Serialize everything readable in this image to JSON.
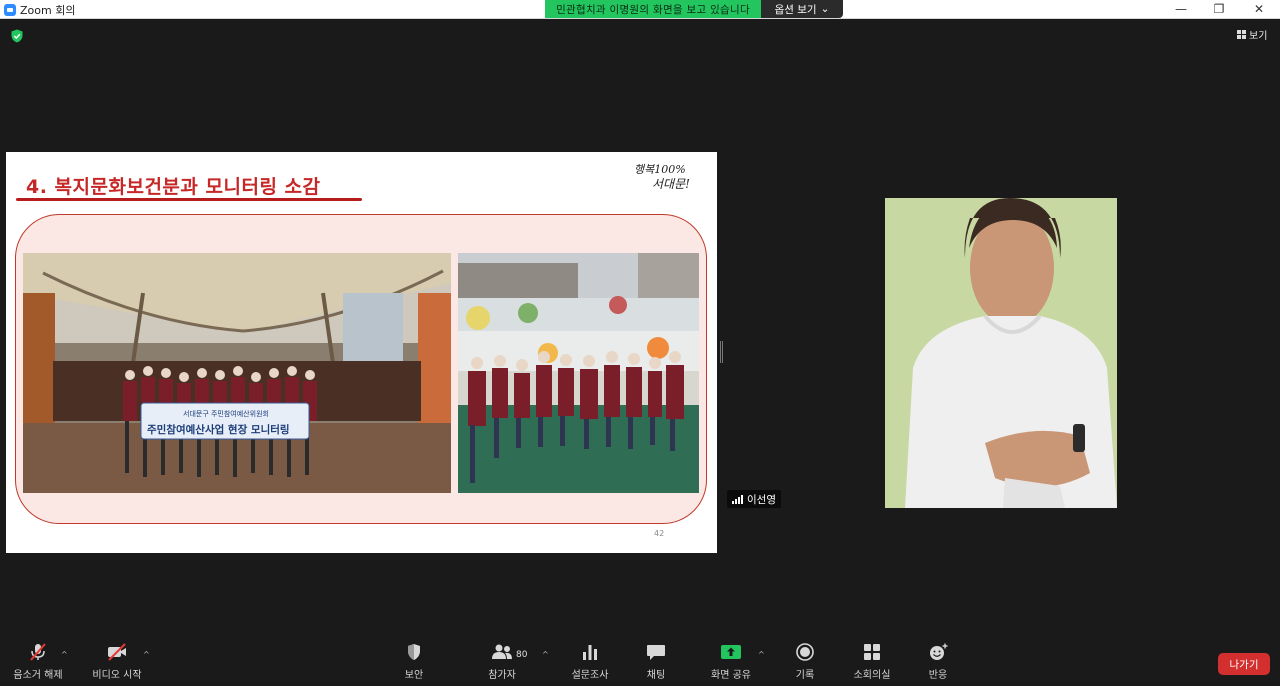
{
  "window": {
    "title": "Zoom 회의",
    "minimize": "—",
    "restore": "❐",
    "close": "✕"
  },
  "share_banner": {
    "text": "민관협치과 이명원의 화면을 보고 있습니다",
    "options_label": "옵션 보기",
    "options_caret": "⌄"
  },
  "view_button": {
    "label": "보기"
  },
  "slide": {
    "title": "4. 복지문화보건분과 모니터링 소감",
    "logo_text_line1": "행복100%",
    "logo_text_line2": "서대문!",
    "banner_org": "서대문구 주민참여예산위원회",
    "banner_text": "주민참여예산사업 현장 모니터링",
    "page_number": "42"
  },
  "participant": {
    "name": "이선영"
  },
  "toolbar": {
    "unmute_label": "음소거 해제",
    "video_label": "비디오 시작",
    "security_label": "보안",
    "participants_label": "참가자",
    "participants_count": "80",
    "poll_label": "설문조사",
    "chat_label": "채팅",
    "share_label": "화면 공유",
    "record_label": "기록",
    "breakout_label": "소회의실",
    "reactions_label": "반응",
    "leave_label": "나가기",
    "caret": "^"
  },
  "colors": {
    "share_banner": "#22c55e",
    "slide_title": "#c62828",
    "leave_button": "#d32f2f",
    "share_icon": "#22c55e",
    "video_bg": "#c8d8a2"
  }
}
